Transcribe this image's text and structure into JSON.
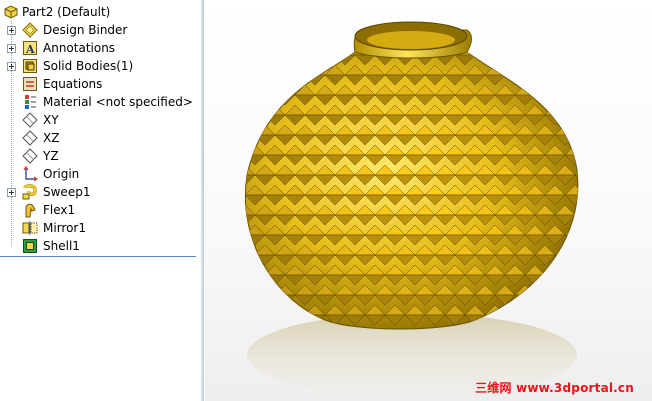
{
  "feature_tree": {
    "root": {
      "label": "Part2  (Default)",
      "icon": "part-icon"
    },
    "items": [
      {
        "label": "Design Binder",
        "icon": "design-binder-icon",
        "expandable": true
      },
      {
        "label": "Annotations",
        "icon": "annotations-icon",
        "expandable": true
      },
      {
        "label": "Solid Bodies(1)",
        "icon": "solid-bodies-icon",
        "expandable": true
      },
      {
        "label": "Equations",
        "icon": "equations-icon",
        "expandable": false
      },
      {
        "label": "Material <not specified>",
        "icon": "material-icon",
        "expandable": false
      },
      {
        "label": "XY",
        "icon": "plane-icon",
        "expandable": false
      },
      {
        "label": "XZ",
        "icon": "plane-icon",
        "expandable": false
      },
      {
        "label": "YZ",
        "icon": "plane-icon",
        "expandable": false
      },
      {
        "label": "Origin",
        "icon": "origin-icon",
        "expandable": false
      },
      {
        "label": "Sweep1",
        "icon": "sweep-icon",
        "expandable": true
      },
      {
        "label": "Flex1",
        "icon": "flex-icon",
        "expandable": false
      },
      {
        "label": "Mirror1",
        "icon": "mirror-icon",
        "expandable": false
      },
      {
        "label": "Shell1",
        "icon": "shell-icon",
        "expandable": false
      }
    ]
  },
  "viewport": {
    "model": "faceted-vase-model",
    "model_color": "#e8c21c",
    "watermark": "三维网 www.3dportal.cn",
    "watermark_color": "#e8141b"
  }
}
